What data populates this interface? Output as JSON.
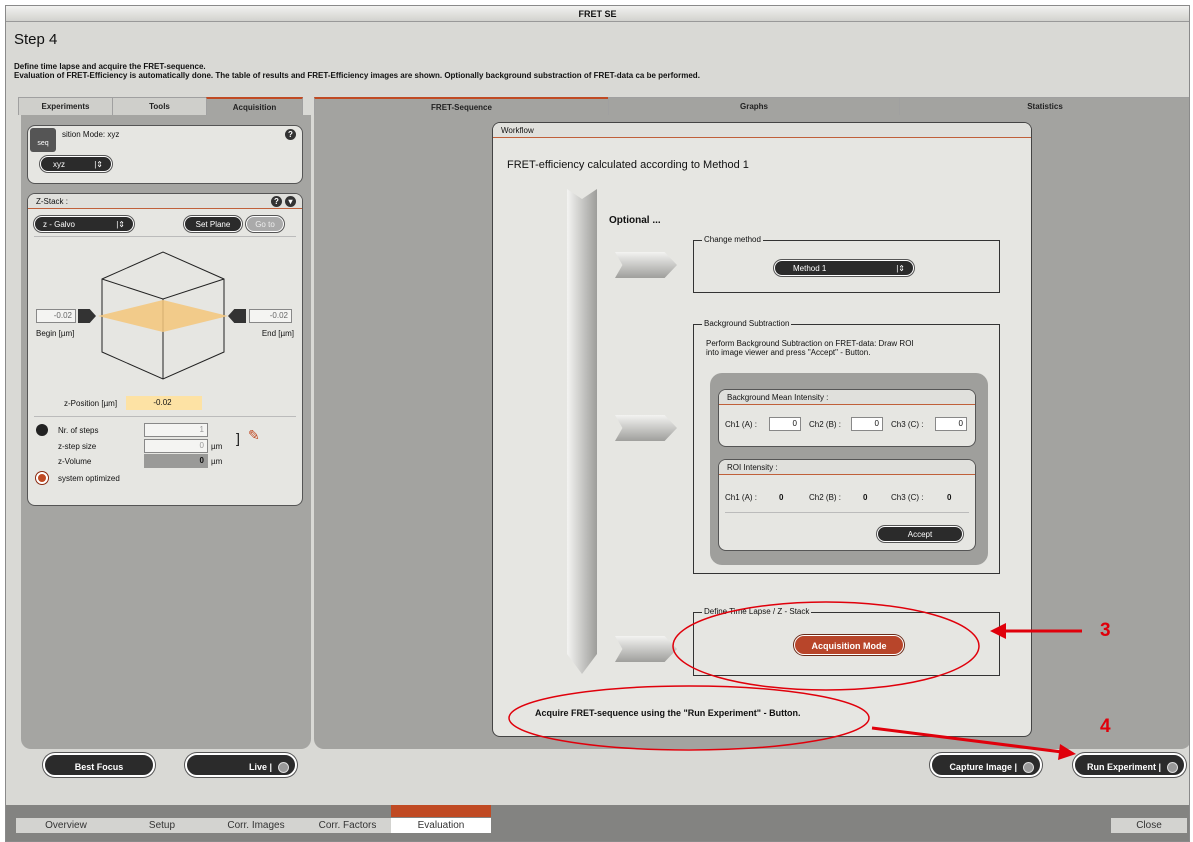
{
  "window": {
    "title": "FRET SE"
  },
  "header": {
    "step": "Step 4",
    "line1": "Define time lapse and acquire the FRET-sequence.",
    "line2": "Evaluation of FRET-Efficiency is automatically done. The table of results and FRET-Efficiency images are shown. Optionally background substraction of FRET-data ca be performed."
  },
  "left_tabs": [
    "Experiments",
    "Tools",
    "Acquisition"
  ],
  "right_tabs": [
    "FRET-Sequence",
    "Graphs",
    "Statistics"
  ],
  "acq_mode": {
    "title": "sition Mode: xyz",
    "seq_label": "seq",
    "select": "xyz"
  },
  "zstack": {
    "title": "Z-Stack :",
    "drive": "z - Galvo",
    "set_plane": "Set Plane",
    "go_to": "Go to",
    "begin_value": "-0.02",
    "end_value": "-0.02",
    "begin_label": "Begin [µm]",
    "end_label": "End [µm]",
    "zpos_label": "z-Position [µm]",
    "zpos_value": "-0.02",
    "nsteps_label": "Nr. of steps",
    "nsteps_value": "1",
    "stepsize_label": "z-step size",
    "stepsize_value": "0",
    "stepsize_unit": "µm",
    "volume_label": "z-Volume",
    "volume_value": "0",
    "volume_unit": "µm",
    "sys_opt": "system optimized"
  },
  "workflow": {
    "title": "Workflow",
    "heading": "FRET-efficiency calculated according to Method 1",
    "optional": "Optional ...",
    "change_method": {
      "title": "Change method",
      "value": "Method 1"
    },
    "bg": {
      "title": "Background Subtraction",
      "text1": "Perform Background Subtraction on FRET-data: Draw ROI",
      "text2": "into image viewer and press \"Accept\" - Button.",
      "mean_title": "Background Mean Intensity :",
      "ch1": "Ch1 (A) :",
      "ch2": "Ch2 (B) :",
      "ch3": "Ch3 (C) :",
      "ch1_val": "0",
      "ch2_val": "0",
      "ch3_val": "0",
      "roi_title": "ROI Intensity :",
      "roi1": "0",
      "roi2": "0",
      "roi3": "0",
      "accept": "Accept"
    },
    "time": {
      "title": "Define Time Lapse / Z - Stack",
      "button": "Acquisition Mode"
    },
    "footer": "Acquire FRET-sequence using the \"Run Experiment\" - Button."
  },
  "bottom_buttons": {
    "best_focus": "Best Focus",
    "live": "Live",
    "capture": "Capture Image",
    "run": "Run Experiment"
  },
  "bottom_tabs": [
    "Overview",
    "Setup",
    "Corr. Images",
    "Corr. Factors",
    "Evaluation"
  ],
  "close": "Close",
  "annotations": {
    "a3": "3",
    "a4": "4"
  },
  "colors": {
    "accent": "#c04a23",
    "annotation": "#e0000b"
  }
}
